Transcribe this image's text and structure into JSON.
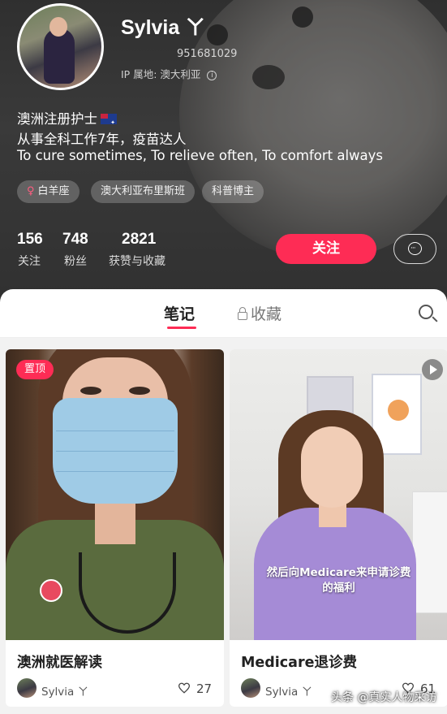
{
  "profile": {
    "name": "Sylvia ㄚ",
    "user_id": "951681029",
    "ip_location": "IP 属地: 澳大利亚",
    "bio_lines": [
      "澳洲注册护士",
      "从事全科工作7年，疫苗达人",
      "To cure sometimes, To relieve often, To comfort always"
    ],
    "tags": [
      {
        "label": "白羊座",
        "icon": "venus-icon"
      },
      {
        "label": "澳大利亚布里斯班"
      },
      {
        "label": "科普博主"
      }
    ],
    "stats": [
      {
        "value": "156",
        "label": "关注"
      },
      {
        "value": "748",
        "label": "粉丝"
      },
      {
        "value": "2821",
        "label": "获赞与收藏"
      }
    ],
    "follow_label": "关注",
    "message_icon": "chat-bubble-icon"
  },
  "tabs": {
    "notes": "笔记",
    "favorites": "收藏",
    "favorites_icon": "lock-icon",
    "search_icon": "search-icon"
  },
  "posts": [
    {
      "title": "澳洲就医解读",
      "badge": "置顶",
      "author": "Sylvia ㄚ",
      "likes": "27",
      "type": "image"
    },
    {
      "title": "Medicare退诊费",
      "caption_lines": [
        "然后向Medicare来申请诊费",
        "的福利"
      ],
      "author": "Sylvia ㄚ",
      "likes": "61",
      "type": "video"
    }
  ],
  "watermark": "头条 @真实人物采访",
  "colors": {
    "accent": "#fe2c55",
    "header_bg": "#3d3d3d"
  }
}
